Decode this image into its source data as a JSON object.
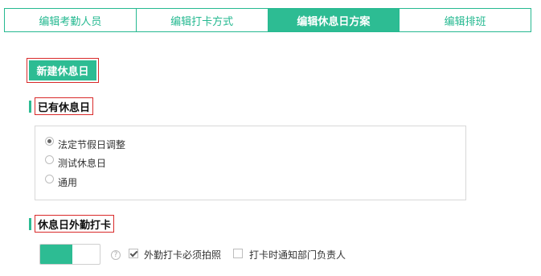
{
  "tabs": [
    {
      "label": "编辑考勤人员",
      "active": false
    },
    {
      "label": "编辑打卡方式",
      "active": false
    },
    {
      "label": "编辑休息日方案",
      "active": true
    },
    {
      "label": "编辑排班",
      "active": false
    }
  ],
  "new_button": {
    "label": "新建休息日"
  },
  "existing": {
    "title": "已有休息日",
    "options": [
      {
        "label": "法定节假日调整",
        "checked": true
      },
      {
        "label": "测试休息日",
        "checked": false
      },
      {
        "label": "通用",
        "checked": false
      }
    ]
  },
  "outside": {
    "title": "休息日外勤打卡",
    "toggle_on": true,
    "help_glyph": "?",
    "photo_label": "外勤打卡必须拍照",
    "photo_checked": true,
    "notify_label": "打卡时通知部门负责人",
    "notify_checked": false
  },
  "colors": {
    "accent": "#2dbc93",
    "highlight": "#d92a2a"
  }
}
